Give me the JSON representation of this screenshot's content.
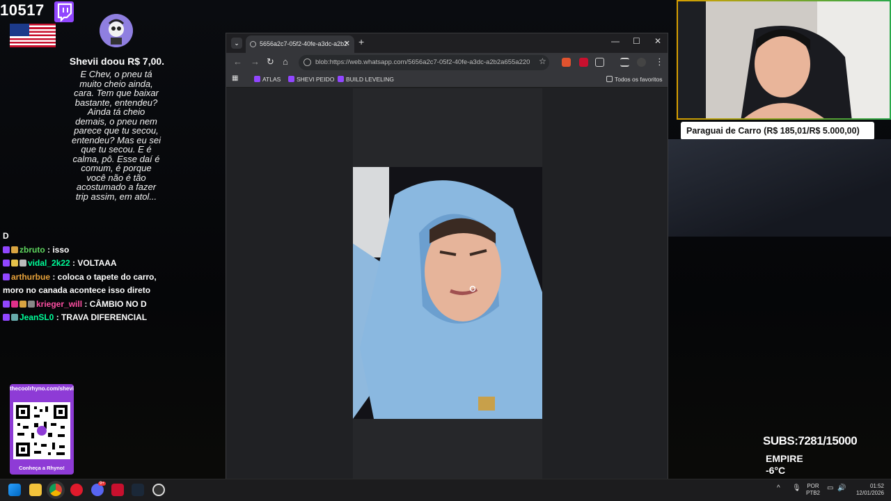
{
  "overlay": {
    "viewer_count": "10517",
    "icons": [
      "twitch-icon",
      "us-flag-icon"
    ],
    "donation_title": "Shevii doou R$ 7,00.",
    "donation_message": "E Chev, o pneu tá muito cheio ainda, cara. Tem que baixar bastante, entendeu? Ainda tá cheio demais, o pneu nem parece que tu secou, entendeu? Mas eu sei que tu secou. E é calma, pô. Esse daí é comum, é porque você não é tão acostumado a fazer trip assim, em atol..."
  },
  "chat": {
    "messages": [
      {
        "user": "",
        "text": "D"
      },
      {
        "user": "zbruto",
        "text": " : isso"
      },
      {
        "user": "vidal_2k22",
        "text": " : VOLTAAA"
      },
      {
        "user": "arthurbue",
        "text": " : coloca o tapete do carro, moro no canada acontece isso direto"
      },
      {
        "user": "krieger_will",
        "text": " : CÂMBIO NO D"
      },
      {
        "user": "JeanSL0",
        "text": " : TRAVA DIFERENCIAL"
      }
    ]
  },
  "qr_card": {
    "url": "thecoolrhyno.com/shevii2k",
    "cta": "Conheça a Rhyno!",
    "accent": "#8e3bd6"
  },
  "browser": {
    "tab_title": "5656a2c7-05f2-40fe-a3dc-a2b2",
    "tab_close": "✕",
    "new_tab": "+",
    "tab_list": "⌄",
    "window_controls": {
      "minimize": "—",
      "maximize": "☐",
      "close": "✕"
    },
    "nav": {
      "back": "←",
      "forward": "→",
      "reload": "↻",
      "home": "⌂"
    },
    "url": "blob:https://web.whatsapp.com/5656a2c7-05f2-40fe-a3dc-a2b2a655a220",
    "menu": "⋮",
    "apps_icon": "▦",
    "bookmarks": [
      {
        "label": "ATLAS"
      },
      {
        "label": "SHEVI PEIDO"
      },
      {
        "label": "BUILD LEVELING"
      }
    ],
    "all_bookmarks": "Todos os favoritos"
  },
  "stream": {
    "goal_text": "Paraguai de Carro (R$ 185,01/R$ 5.000,00)",
    "subs_text": "SUBS:7281/15000",
    "location": "EMPIRE",
    "temperature": "-6°C"
  },
  "taskbar": {
    "lang_line1": "POR",
    "lang_line2": "PTB2",
    "time": "01:52",
    "date": "12/01/2026",
    "badge_count": "9+",
    "chevron": "^"
  }
}
